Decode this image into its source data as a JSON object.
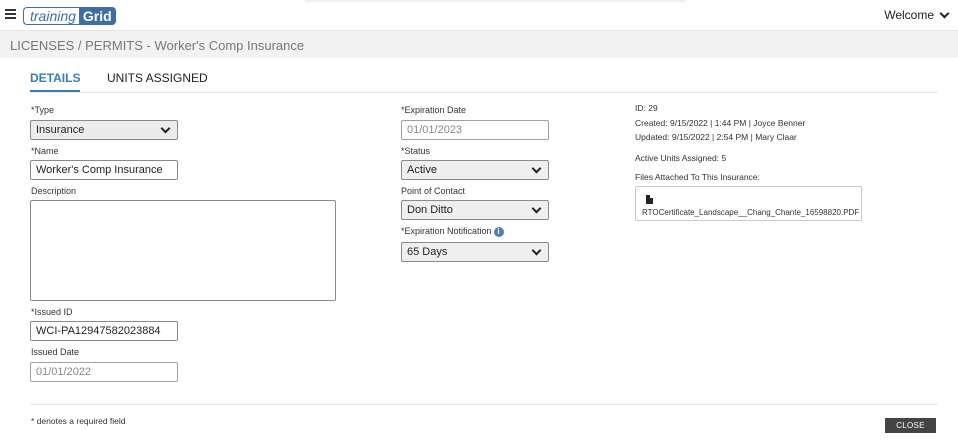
{
  "header": {
    "logo_part1": "training",
    "logo_part2": "Grid",
    "welcome": "Welcome"
  },
  "page_title": "LICENSES / PERMITS - Worker's Comp Insurance",
  "tabs": [
    {
      "label": "DETAILS",
      "active": true
    },
    {
      "label": "UNITS ASSIGNED",
      "active": false
    }
  ],
  "form": {
    "type_label": "*Type",
    "type_value": "Insurance",
    "name_label": "*Name",
    "name_value": "Worker's Comp Insurance",
    "description_label": "Description",
    "description_value": "",
    "issued_id_label": "*Issued ID",
    "issued_id_value": "WCI-PA12947582023884",
    "issued_date_label": "Issued Date",
    "issued_date_value": "01/01/2022",
    "expiration_date_label": "*Expiration Date",
    "expiration_date_value": "01/01/2023",
    "status_label": "*Status",
    "status_value": "Active",
    "poc_label": "Point of Contact",
    "poc_value": "Don Ditto",
    "exp_notification_label": "*Expiration Notification",
    "exp_notification_value": "65 Days"
  },
  "meta": {
    "id": "ID: 29",
    "created": "Created: 9/15/2022 | 1:44 PM | Joyce Benner",
    "updated": "Updated: 9/15/2022 | 2:54 PM | Mary Claar",
    "active_units": "Active Units Assigned: 5",
    "files_label": "Files Attached To This Insurance:",
    "file_name": "RTOCertificate_Landscape__Chang_Chante_16598820.PDF"
  },
  "footer": {
    "required_note": "* denotes a required field",
    "close_label": "CLOSE"
  },
  "colors": {
    "accent": "#3c7cb6",
    "button_dark": "#444444"
  }
}
